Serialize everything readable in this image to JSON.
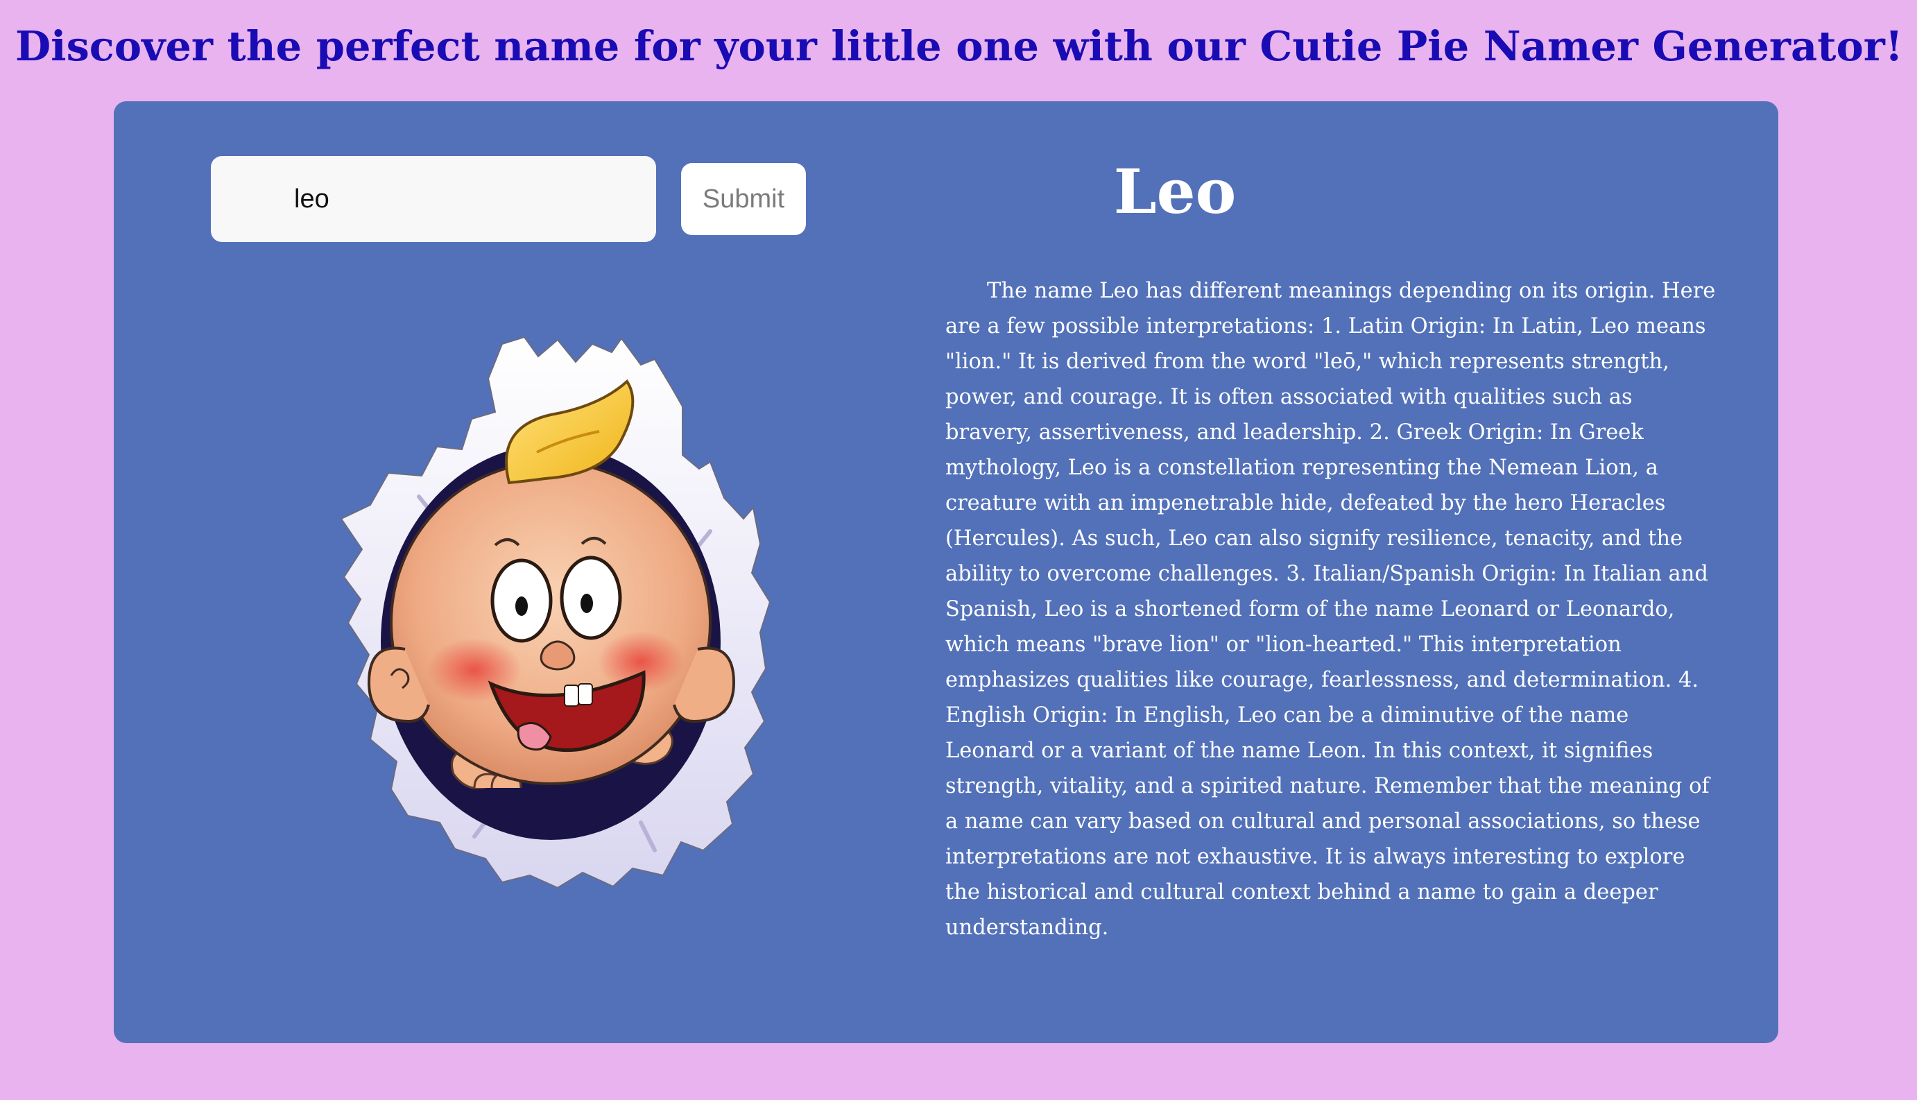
{
  "header": {
    "title": "Discover the perfect name for your little one with our Cutie Pie Namer Generator!"
  },
  "form": {
    "name_value": "leo",
    "submit_label": "Submit"
  },
  "illustration": {
    "icon": "cartoon-baby-icon"
  },
  "result": {
    "name": "Leo",
    "meaning": "The name Leo has different meanings depending on its origin. Here are a few possible interpretations: 1. Latin Origin: In Latin, Leo means \"lion.\" It is derived from the word \"leō,\" which represents strength, power, and courage. It is often associated with qualities such as bravery, assertiveness, and leadership. 2. Greek Origin: In Greek mythology, Leo is a constellation representing the Nemean Lion, a creature with an impenetrable hide, defeated by the hero Heracles (Hercules). As such, Leo can also signify resilience, tenacity, and the ability to overcome challenges. 3. Italian/Spanish Origin: In Italian and Spanish, Leo is a shortened form of the name Leonard or Leonardo, which means \"brave lion\" or \"lion-hearted.\" This interpretation emphasizes qualities like courage, fearlessness, and determination. 4. English Origin: In English, Leo can be a diminutive of the name Leonard or a variant of the name Leon. In this context, it signifies strength, vitality, and a spirited nature. Remember that the meaning of a name can vary based on cultural and personal associations, so these interpretations are not exhaustive. It is always interesting to explore the historical and cultural context behind a name to gain a deeper understanding."
  },
  "colors": {
    "page_background": "#e9b3ef",
    "heading": "#1a0cb4",
    "card_background": "#5271b9",
    "result_text": "#ffffff"
  }
}
